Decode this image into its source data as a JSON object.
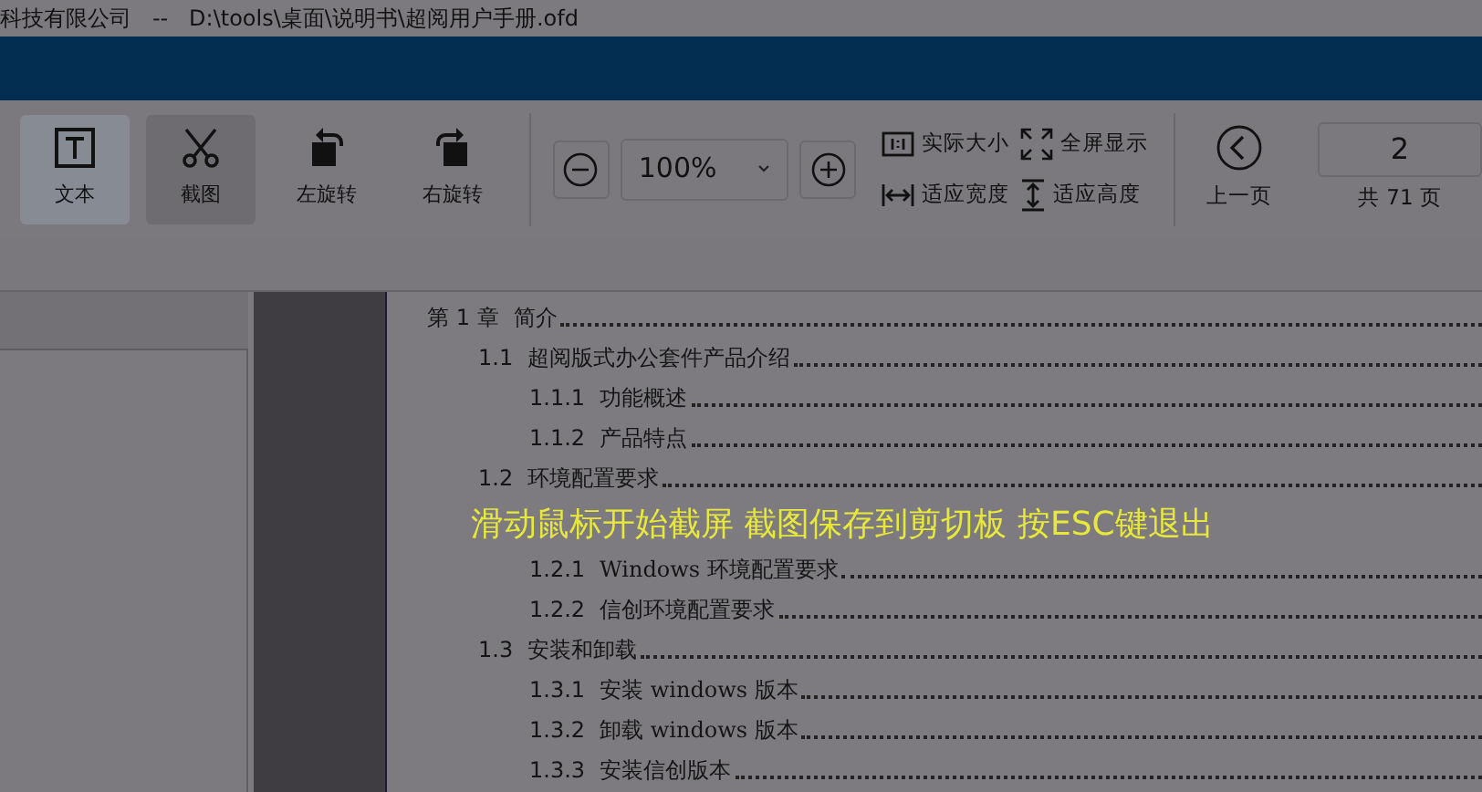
{
  "window": {
    "title": "科技有限公司   --   D:\\tools\\桌面\\说明书\\超阅用户手册.ofd"
  },
  "toolbar": {
    "tools": [
      {
        "kind": "text",
        "label": "文本",
        "hover": true,
        "selected": false
      },
      {
        "kind": "scissors",
        "label": "截图",
        "hover": false,
        "selected": true
      },
      {
        "kind": "rotate-left",
        "label": "左旋转",
        "hover": false,
        "selected": false
      },
      {
        "kind": "rotate-right",
        "label": "右旋转",
        "hover": false,
        "selected": false
      }
    ],
    "zoom": {
      "value": "100%"
    },
    "fit": [
      {
        "kind": "actual",
        "label": "实际大小"
      },
      {
        "kind": "fullscreen",
        "label": "全屏显示"
      },
      {
        "kind": "width",
        "label": "适应宽度"
      },
      {
        "kind": "height",
        "label": "适应高度"
      }
    ],
    "prev_page": {
      "label": "上一页"
    },
    "page": {
      "value": "2",
      "total": "共 71 页"
    }
  },
  "toc": [
    {
      "number": "第 1 章",
      "title": "简介",
      "children": [
        {
          "number": "1.1",
          "title": "超阅版式办公套件产品介绍",
          "children": [
            {
              "number": "1.1.1",
              "title": "功能概述"
            },
            {
              "number": "1.1.2",
              "title": "产品特点"
            }
          ]
        },
        {
          "number": "1.2",
          "title": "环境配置要求",
          "children": [
            {
              "number": "1.2.1",
              "title": "Windows 环境配置要求"
            },
            {
              "number": "1.2.2",
              "title": "信创环境配置要求"
            }
          ]
        },
        {
          "number": "1.3",
          "title": "安装和卸载",
          "children": [
            {
              "number": "1.3.1",
              "title": "安装 windows 版本"
            },
            {
              "number": "1.3.2",
              "title": "卸载 windows 版本"
            },
            {
              "number": "1.3.3",
              "title": "安装信创版本"
            }
          ]
        }
      ]
    }
  ],
  "overlay_message": "滑动鼠标开始截屏 截图保存到剪切板 按ESC键退出"
}
